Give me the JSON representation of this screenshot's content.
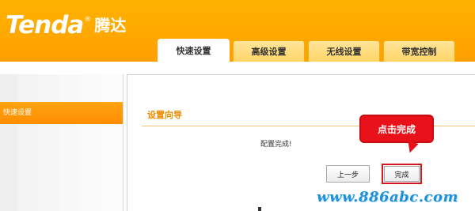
{
  "brand": {
    "logo_en": "Tenda",
    "logo_reg": "®",
    "logo_cn": "腾达"
  },
  "tabs": [
    {
      "label": "快速设置",
      "active": true
    },
    {
      "label": "高级设置",
      "active": false
    },
    {
      "label": "无线设置",
      "active": false
    },
    {
      "label": "带宽控制",
      "active": false
    }
  ],
  "sidebar": {
    "items": [
      {
        "label": "快速设置",
        "selected": true
      }
    ]
  },
  "main": {
    "title": "设置向导",
    "message": "配置完成!",
    "prev_button": "上一步",
    "finish_button": "完成"
  },
  "callout": {
    "text": "点击完成"
  },
  "watermark": "www.886abc.com",
  "colors": {
    "header": "#ffa800",
    "accent_orange": "#ff9400",
    "title_orange": "#f08c00",
    "callout_red": "#e8111a",
    "watermark_blue": "#1e8fd8"
  }
}
